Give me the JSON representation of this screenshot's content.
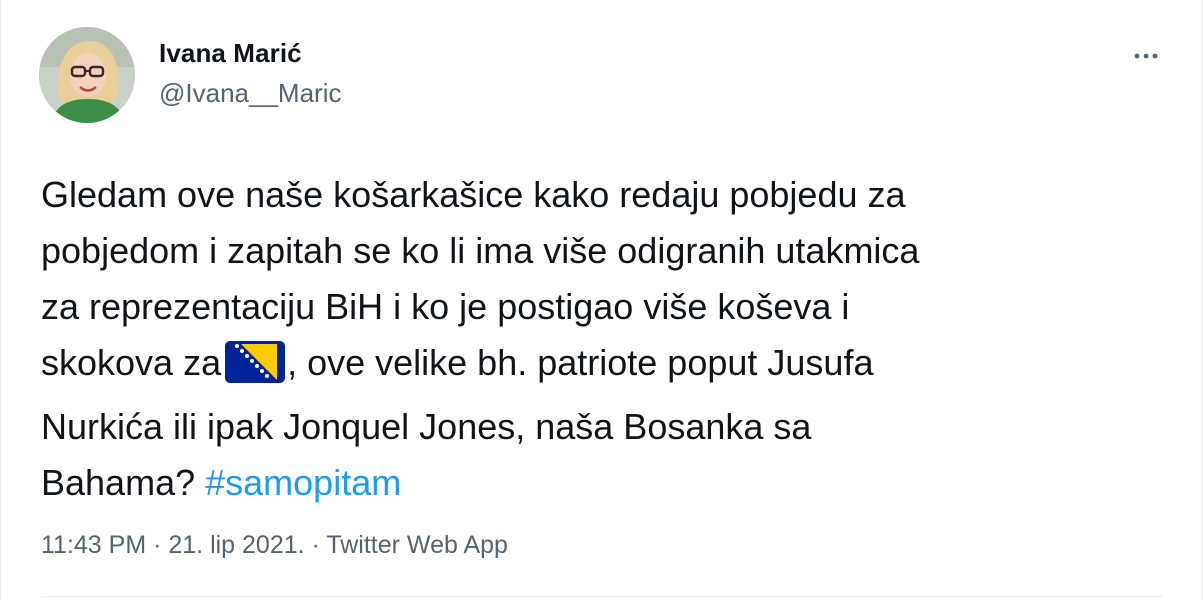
{
  "author": {
    "name": "Ivana Marić",
    "handle": "@Ivana__Maric"
  },
  "tweet": {
    "line1": "Gledam ove naše košarkašice kako redaju pobjedu za",
    "line2": "pobjedom i zapitah se ko li ima više odigranih utakmica",
    "line3": "za reprezentaciju BiH i ko je postigao više koševa i",
    "line4_before": "skokova za",
    "line4_after": ", ove velike bh. patriote poput Jusufa",
    "line5": "Nurkića ili ipak Jonquel Jones, naša Bosanka sa",
    "line6": "Bahama?",
    "hashtag": "#samopitam"
  },
  "meta": {
    "time": "11:43 PM",
    "sep1": " · ",
    "date": "21. lip 2021.",
    "sep2": " · ",
    "source": "Twitter Web App"
  },
  "icons": {
    "more": "more-dots-icon",
    "flag": "bosnia-flag-emoji"
  },
  "colors": {
    "text": "#0f1419",
    "secondary": "#536471",
    "hashtag": "#1d9bf0",
    "flag_blue": "#002395",
    "flag_yellow": "#fecb00"
  }
}
